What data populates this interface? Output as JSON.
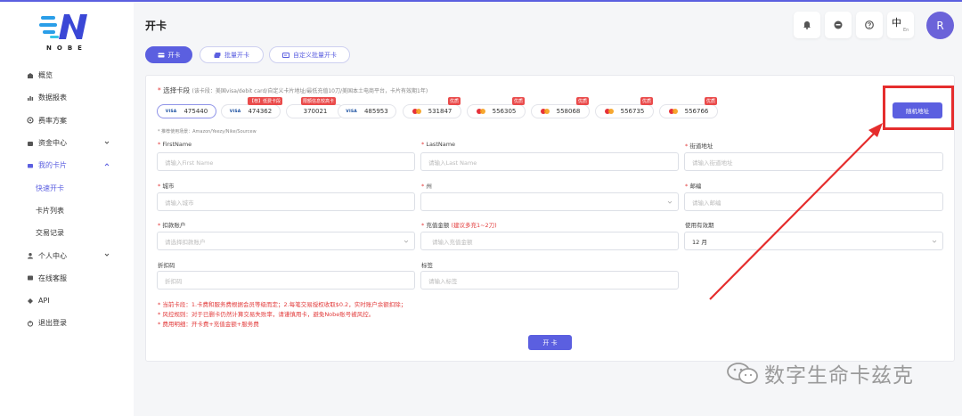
{
  "brand": {
    "logo_text": "NOBE"
  },
  "sidebar": {
    "items": [
      {
        "label": "概览",
        "icon": "dashboard-icon"
      },
      {
        "label": "数据报表",
        "icon": "chart-icon"
      },
      {
        "label": "费率方案",
        "icon": "rate-icon"
      },
      {
        "label": "资金中心",
        "icon": "wallet-icon"
      },
      {
        "label": "我的卡片",
        "icon": "card-icon"
      },
      {
        "label": "快速开卡"
      },
      {
        "label": "卡片列表"
      },
      {
        "label": "交易记录"
      },
      {
        "label": "个人中心",
        "icon": "user-icon"
      },
      {
        "label": "在线客服",
        "icon": "support-icon"
      },
      {
        "label": "API",
        "icon": "api-icon"
      },
      {
        "label": "退出登录",
        "icon": "logout-icon"
      }
    ]
  },
  "header": {
    "title": "开卡",
    "lang_zh": "中",
    "lang_en": "En",
    "avatar": "R"
  },
  "tabs": [
    {
      "label": "开卡"
    },
    {
      "label": "批量开卡"
    },
    {
      "label": "自定义批量开卡"
    }
  ],
  "card_select": {
    "label": "选择卡段",
    "hint": "(该卡段：美国visa/debit card/自定义卡片地址/最低充值10刀/美国本土电商平台，卡片有效期1年)",
    "chips": [
      {
        "brand": "VISA",
        "number": "475440"
      },
      {
        "brand": "VISA",
        "number": "474362",
        "badge": "【荐】低费卡段"
      },
      {
        "number": "370021",
        "badge": "限额信息较高卡"
      },
      {
        "brand": "VISA",
        "number": "485953"
      },
      {
        "brand": "MC",
        "number": "531847",
        "badge": "优质"
      },
      {
        "brand": "MC",
        "number": "556305",
        "badge": "优质"
      },
      {
        "brand": "MC",
        "number": "558068",
        "badge": "优质"
      },
      {
        "brand": "MC",
        "number": "556735",
        "badge": "优质"
      },
      {
        "brand": "MC",
        "number": "556766",
        "badge": "优质"
      }
    ],
    "scene_note": "* 推荐使用场景：Amazon/Yeezy/Nike/Sourcew",
    "random_button": "随机地址"
  },
  "form": {
    "first_name": {
      "label": "FirstName",
      "placeholder": "请输入First Name"
    },
    "last_name": {
      "label": "LastName",
      "placeholder": "请输入Last Name"
    },
    "street": {
      "label": "街道地址",
      "placeholder": "请输入街道地址"
    },
    "city": {
      "label": "城市",
      "placeholder": "请输入城市"
    },
    "state": {
      "label": "州",
      "placeholder": ""
    },
    "zip": {
      "label": "邮编",
      "placeholder": "请输入邮编"
    },
    "deduct_account": {
      "label": "扣款账户",
      "placeholder": "请选择扣款账户"
    },
    "amount": {
      "label": "充值金额",
      "hint": "(建议多充1~2刀)",
      "placeholder": "请输入充值金额"
    },
    "validity": {
      "label": "使用有效期",
      "value": "12 月"
    },
    "discount": {
      "label": "折扣码",
      "placeholder": "折扣码"
    },
    "tag": {
      "label": "标签",
      "placeholder": "请输入标签"
    }
  },
  "notes": {
    "line1": "* 当前卡段：1.卡费和服务费根据会员等级而定；2.每笔交易授权收取$0.2，实时账户余额扣除；",
    "line2": "* 风控规则：对于已删卡仍然计算交易失败率，请谨慎用卡，避免Nobe账号被风控。",
    "line3": "* 费用明细：开卡费+充值金额+服务费"
  },
  "submit_label": "开 卡",
  "watermark": "数字生命卡兹克",
  "colors": {
    "accent": "#5b5fe0",
    "danger": "#e23b3b",
    "highlight": "#e52d2d"
  }
}
